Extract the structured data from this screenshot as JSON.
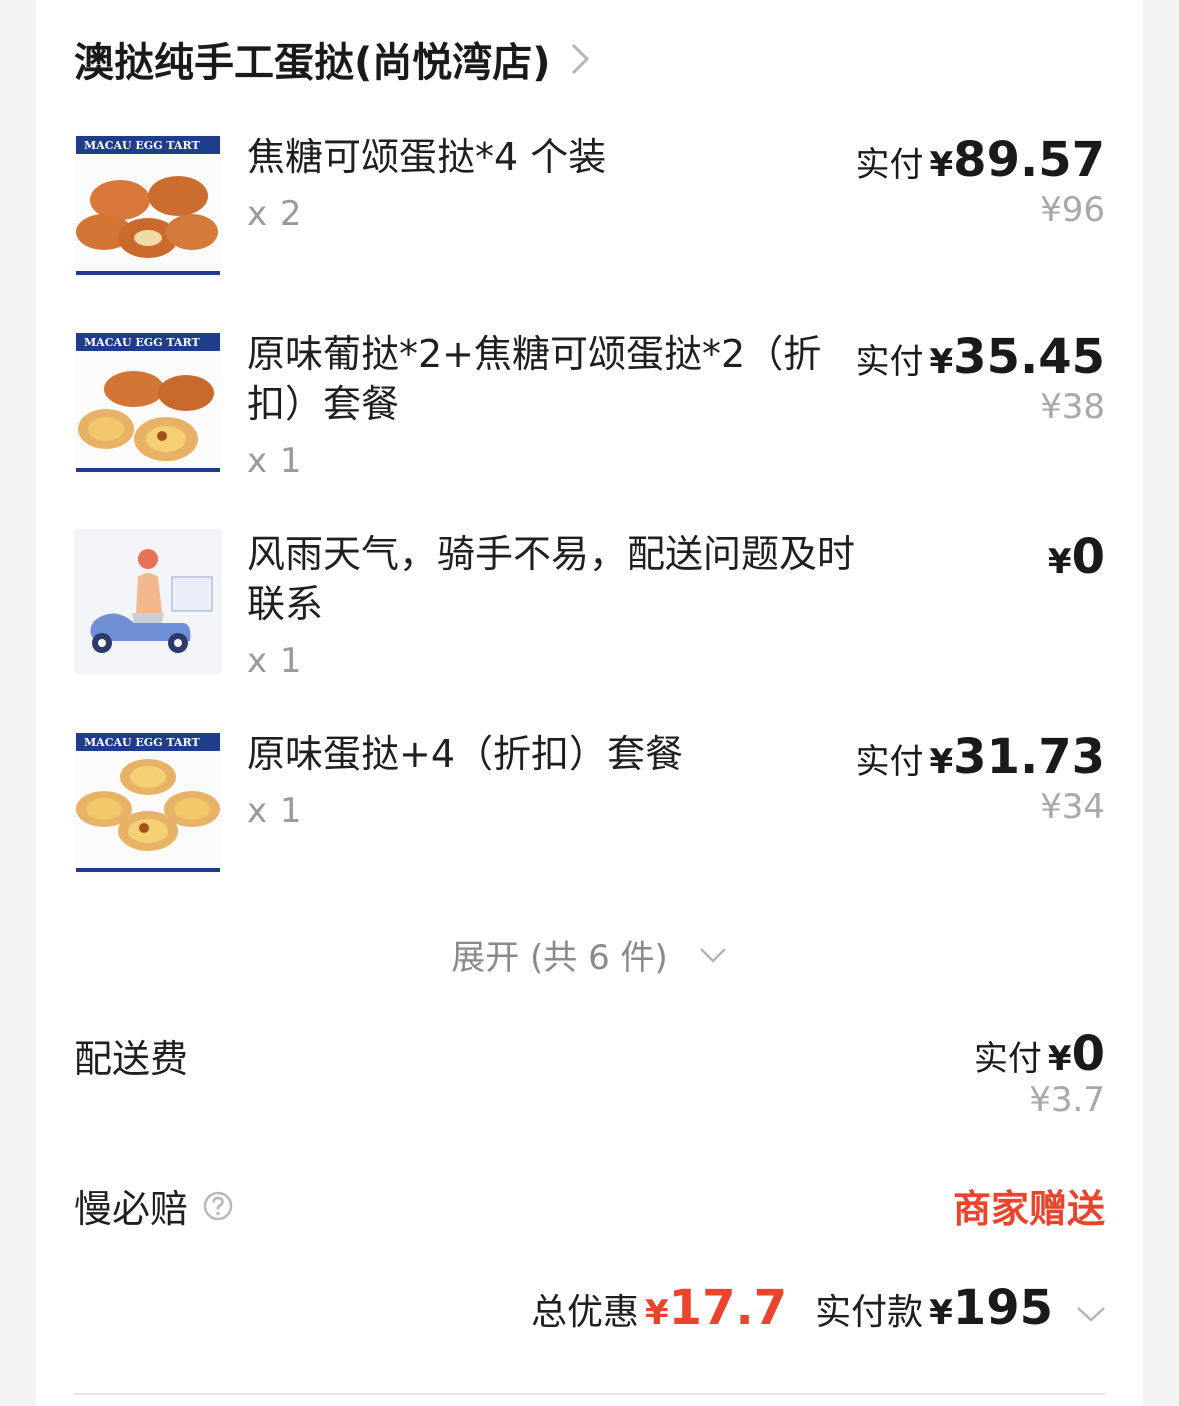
{
  "shop": {
    "name": "澳挞纯手工蛋挞(尚悦湾店)"
  },
  "items": [
    {
      "name": "焦糖可颂蛋挞*4 个装",
      "qty": "x 2",
      "paid_label": "实付",
      "currency": "¥",
      "paid": "89.57",
      "original": "¥96",
      "thumb_text": "MACAU EGG TART"
    },
    {
      "name": "原味葡挞*2+焦糖可颂蛋挞*2（折扣）套餐",
      "qty": "x 1",
      "paid_label": "实付",
      "currency": "¥",
      "paid": "35.45",
      "original": "¥38",
      "thumb_text": "MACAU EGG TART"
    },
    {
      "name": "风雨天气，骑手不易，配送问题及时联系",
      "qty": "x 1",
      "paid_label": "",
      "currency": "¥",
      "paid": "0",
      "original": ""
    },
    {
      "name": "原味蛋挞+4（折扣）套餐",
      "qty": "x 1",
      "paid_label": "实付",
      "currency": "¥",
      "paid": "31.73",
      "original": "¥34",
      "thumb_text": "MACAU EGG TART"
    }
  ],
  "expand": {
    "label": "展开 (共 6 件)"
  },
  "delivery": {
    "label": "配送费",
    "paid_label": "实付",
    "currency": "¥",
    "paid": "0",
    "original": "¥3.7"
  },
  "slow_compensation": {
    "label": "慢必赔",
    "value": "商家赠送"
  },
  "summary": {
    "discount_label": "总优惠",
    "discount_currency": "¥",
    "discount": "17.7",
    "paid_label": "实付款",
    "paid_currency": "¥",
    "paid": "195"
  },
  "colors": {
    "accent_red": "#e8452c",
    "muted": "#a8a8a8",
    "tart_brand_blue": "#1f3d8a"
  }
}
